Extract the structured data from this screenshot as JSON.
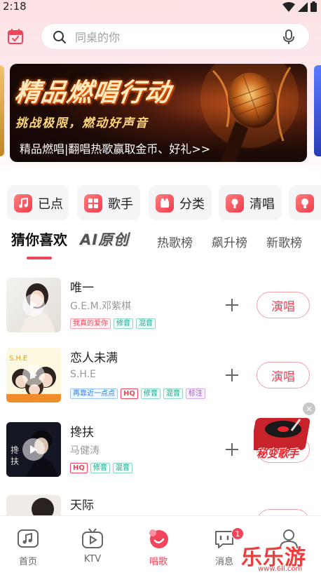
{
  "status_bar": {
    "time": "2:18"
  },
  "search": {
    "placeholder": "同桌的你"
  },
  "banner": {
    "title": "精品燃唱行动",
    "subtitle": "挑战极限，燃动好声音",
    "caption": "精品燃唱|翻唱热歌赢取金币、好礼>>"
  },
  "quick_categories": [
    {
      "label": "已点",
      "icon": "music-note-icon"
    },
    {
      "label": "歌手",
      "icon": "grid-icon"
    },
    {
      "label": "分类",
      "icon": "category-icon"
    },
    {
      "label": "清唱",
      "icon": "microphone-icon"
    }
  ],
  "tabs": [
    {
      "label": "猜你喜欢",
      "active": true
    },
    {
      "label": "AI原创"
    },
    {
      "label": "热歌榜"
    },
    {
      "label": "飙升榜"
    },
    {
      "label": "新歌榜"
    }
  ],
  "songs": [
    {
      "title": "唯一",
      "artist": "G.E.M.邓紫棋",
      "tags": [
        "我真的爱你",
        "修音",
        "混音"
      ],
      "action": "演唱"
    },
    {
      "title": "恋人未满",
      "artist": "S.H.E",
      "tags": [
        "再靠近一点点",
        "HQ",
        "修音",
        "混音",
        "标注"
      ],
      "action": "演唱"
    },
    {
      "title": "搀扶",
      "artist": "马健涛",
      "tags": [
        "HQ",
        "修音",
        "混音"
      ],
      "action": "演唱"
    },
    {
      "title": "天际",
      "artist": "",
      "tags": [],
      "action": "演唱"
    }
  ],
  "float_promo": {
    "label": "秘变歌手",
    "close": "×"
  },
  "bottom_nav": [
    {
      "label": "首页"
    },
    {
      "label": "KTV"
    },
    {
      "label": "唱歌",
      "active": true
    },
    {
      "label": "消息",
      "badge": "1"
    },
    {
      "label": ""
    }
  ],
  "watermark": {
    "text": "乐乐游戏",
    "url": "www.6ll.com"
  },
  "colors": {
    "accent": "#f0455a",
    "tag_green": "#19a88a",
    "tag_blue": "#2a7ee6"
  }
}
